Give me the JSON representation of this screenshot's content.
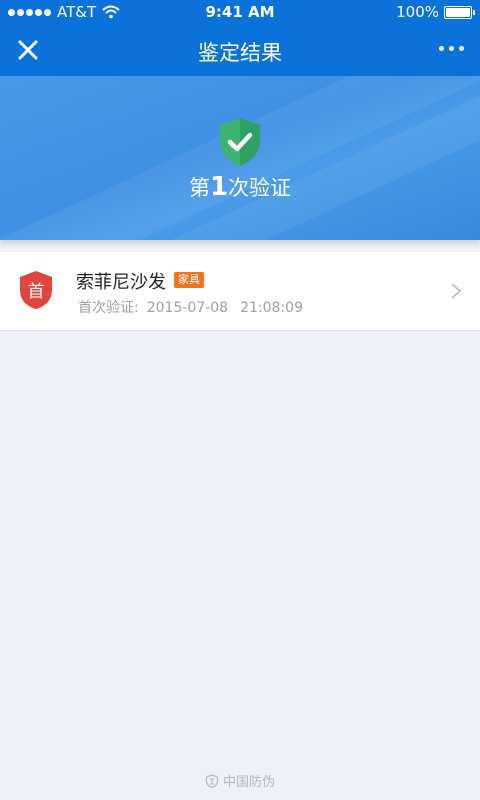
{
  "status_bar": {
    "carrier": "AT&T",
    "time": "9:41 AM",
    "battery": "100%",
    "battery_level": 1.0
  },
  "nav": {
    "title": "鉴定结果",
    "close_icon": "close-icon",
    "more_icon": "more-icon"
  },
  "hero": {
    "prefix": "第",
    "count": "1",
    "suffix": "次验证",
    "icon": "shield-check-icon",
    "icon_color": "#3cb371"
  },
  "record": {
    "badge_text": "首",
    "badge_color": "#e0453e",
    "name": "索菲尼沙发",
    "tag": "家具",
    "tag_color": "#f0741e",
    "meta_label": "首次验证:",
    "date": "2015-07-08",
    "time": "21:08:09"
  },
  "footer": {
    "text": "中国防伪",
    "icon": "seal-icon"
  }
}
